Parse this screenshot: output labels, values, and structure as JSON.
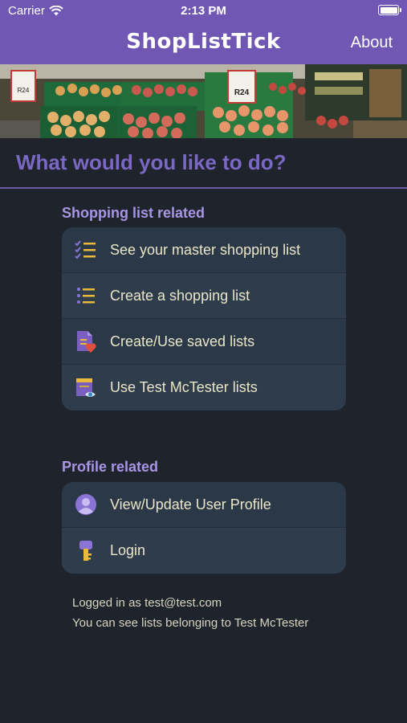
{
  "status_bar": {
    "carrier": "Carrier",
    "time": "2:13 PM"
  },
  "nav": {
    "title": "ShopListTick",
    "about_label": "About"
  },
  "banner": {
    "price_tags": [
      "R24",
      "R24"
    ]
  },
  "main": {
    "question": "What would you like to do?",
    "shopping_section": {
      "label": "Shopping list related",
      "items": [
        {
          "label": "See your master shopping list",
          "icon": "checklist-icon"
        },
        {
          "label": "Create a shopping list",
          "icon": "list-icon"
        },
        {
          "label": "Create/Use saved lists",
          "icon": "saved-list-icon"
        },
        {
          "label": "Use Test McTester lists",
          "icon": "shared-list-icon"
        }
      ]
    },
    "profile_section": {
      "label": "Profile related",
      "items": [
        {
          "label": "View/Update User Profile",
          "icon": "user-avatar-icon"
        },
        {
          "label": "Login",
          "icon": "key-icon"
        }
      ]
    },
    "footer": {
      "logged_in": "Logged in as test@test.com",
      "lists_info": "You can see lists belonging to Test McTester"
    }
  },
  "colors": {
    "accent": "#7057b4",
    "background": "#1f232b",
    "card": "#2b3847",
    "section_label": "#a995e6"
  }
}
